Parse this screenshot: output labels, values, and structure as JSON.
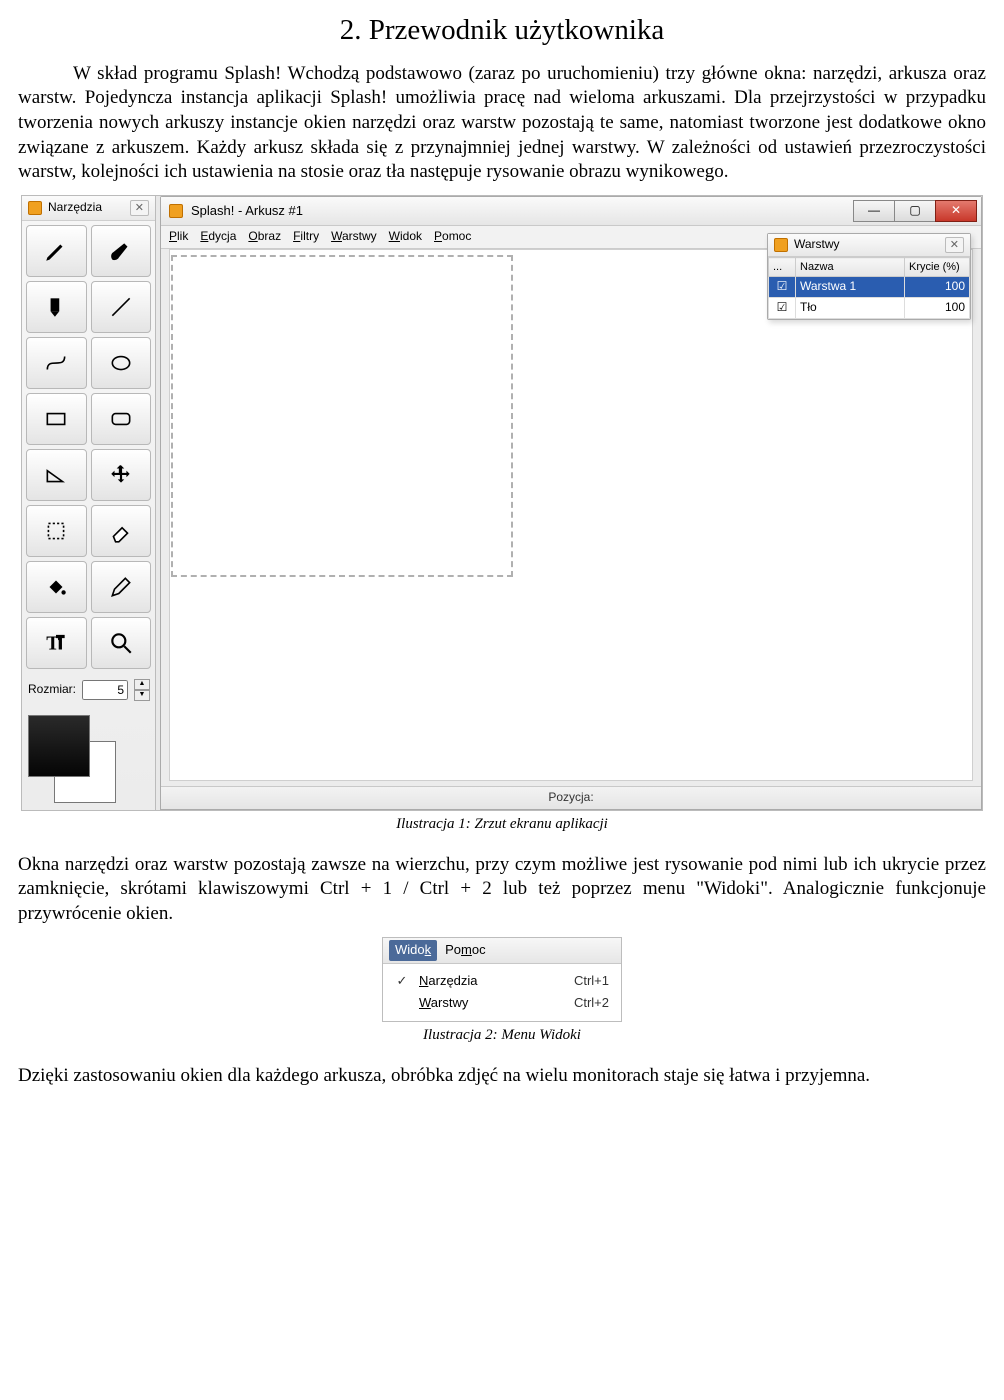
{
  "doc": {
    "title": "2. Przewodnik użytkownika",
    "para1": "W skład programu Splash! Wchodzą podstawowo (zaraz po uruchomieniu) trzy główne okna: narzędzi, arkusza oraz warstw. Pojedyncza instancja aplikacji Splash! umożliwia pracę nad wieloma arkuszami. Dla przejrzystości w przypadku tworzenia nowych arkuszy instancje okien narzędzi oraz warstw pozostają te same, natomiast tworzone jest dodatkowe okno związane z arkuszem. Każdy arkusz składa się z przynajmniej jednej warstwy. W zależności od ustawień przezroczystości warstw, kolejności ich ustawienia na stosie oraz tła następuje rysowanie obrazu wynikowego.",
    "caption1": "Ilustracja 1: Zrzut ekranu aplikacji",
    "para2": "Okna narzędzi oraz warstw pozostają zawsze na wierzchu, przy czym możliwe jest rysowanie pod nimi lub ich ukrycie przez zamknięcie, skrótami klawiszowymi Ctrl + 1 / Ctrl + 2 lub też poprzez menu \"Widoki\". Analogicznie funkcjonuje przywrócenie okien.",
    "caption2": "Ilustracja 2: Menu Widoki",
    "para3": "Dzięki zastosowaniu okien dla każdego arkusza, obróbka zdjęć na wielu monitorach staje się łatwa i przyjemna."
  },
  "app": {
    "tools_title": "Narzędzia",
    "main_title": "Splash! - Arkusz #1",
    "menubar": [
      "Plik",
      "Edycja",
      "Obraz",
      "Filtry",
      "Warstwy",
      "Widok",
      "Pomoc"
    ],
    "size_label": "Rozmiar:",
    "size_value": "5",
    "status_label": "Pozycja:",
    "layers_title": "Warstwy",
    "layers_cols": {
      "c0": "...",
      "c1": "Nazwa",
      "c2": "Krycie (%)"
    },
    "layers_rows": [
      {
        "checked": true,
        "name": "Warstwa 1",
        "opacity": "100",
        "selected": true
      },
      {
        "checked": true,
        "name": "Tło",
        "opacity": "100",
        "selected": false
      }
    ],
    "tool_names": [
      "pencil-tool",
      "brush-tool",
      "fill-tool",
      "line-tool",
      "curve-tool",
      "ellipse-tool",
      "rectangle-tool",
      "rounded-rect-tool",
      "polygon-tool",
      "move-tool",
      "select-tool",
      "eraser-tool",
      "bucket-tool",
      "picker-tool",
      "text-tool",
      "zoom-tool"
    ]
  },
  "menu2": {
    "head_active": "Widok",
    "head_other": "Pomoc",
    "items": [
      {
        "checked": true,
        "label": "Narzędzia",
        "shortcut": "Ctrl+1"
      },
      {
        "checked": false,
        "label": "Warstwy",
        "shortcut": "Ctrl+2"
      }
    ]
  }
}
